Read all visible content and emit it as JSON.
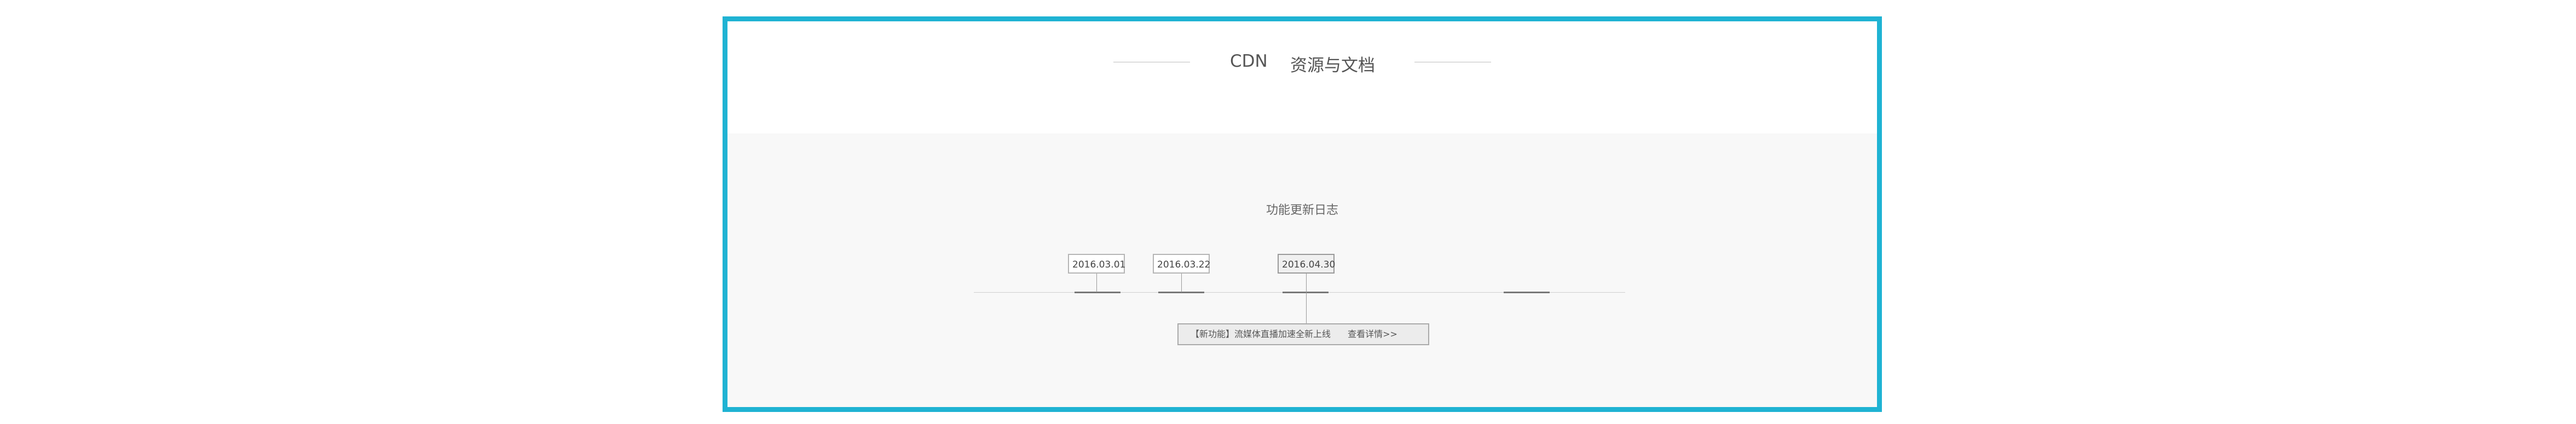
{
  "header": {
    "brand": "CDN",
    "title": "资源与文档"
  },
  "changelog": {
    "heading": "功能更新日志",
    "dates": [
      "2016.03.01",
      "2016.03.22",
      "2016.04.30"
    ],
    "active_date": "2016.04.30",
    "news": {
      "text": "【新功能】流媒体直播加速全新上线",
      "link": "查看详情>>"
    }
  },
  "colors": {
    "frame_border": "#1fb3d3",
    "section_bg": "#f8f8f8"
  }
}
